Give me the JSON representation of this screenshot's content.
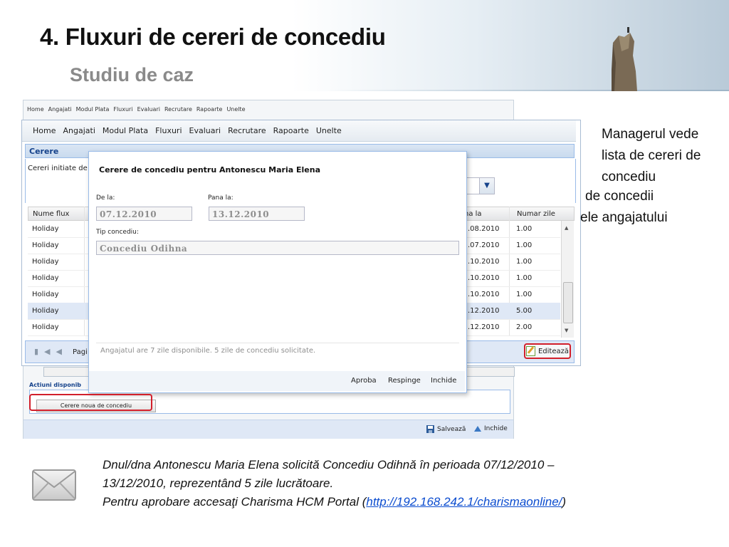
{
  "slide": {
    "title": "4. Fluxuri de cereri de concediu",
    "subtitle": "Studiu de caz"
  },
  "back_window": {
    "menu": [
      "Home",
      "Angajati",
      "Modul Plata",
      "Fluxuri",
      "Evaluari",
      "Recrutare",
      "Rapoarte",
      "Unelte"
    ],
    "actions_label": "Actiuni disponib",
    "new_request_button": "Cerere noua de concediu",
    "save_label": "Salvează",
    "close_label": "Inchide"
  },
  "mid_window": {
    "menu": [
      "Home",
      "Angajati",
      "Modul Plata",
      "Fluxuri",
      "Evaluari",
      "Recrutare",
      "Rapoarte",
      "Unelte"
    ],
    "panel_title": "Cerere",
    "filter_label": "Cereri initiate de",
    "grid": {
      "columns": [
        "Nume flux",
        "na la",
        "Numar zile"
      ],
      "rows": [
        {
          "flux": "Holiday",
          "end": ".08.2010",
          "days": "1.00",
          "selected": false
        },
        {
          "flux": "Holiday",
          "end": ".07.2010",
          "days": "1.00",
          "selected": false
        },
        {
          "flux": "Holiday",
          "end": ".10.2010",
          "days": "1.00",
          "selected": false
        },
        {
          "flux": "Holiday",
          "end": ".10.2010",
          "days": "1.00",
          "selected": false
        },
        {
          "flux": "Holiday",
          "end": ".10.2010",
          "days": "1.00",
          "selected": false
        },
        {
          "flux": "Holiday",
          "end": ".12.2010",
          "days": "5.00",
          "selected": true
        },
        {
          "flux": "Holiday",
          "end": ".12.2010",
          "days": "2.00",
          "selected": false
        }
      ]
    },
    "pager_label": "Pagi",
    "edit_button": "Editează"
  },
  "modal": {
    "title": "Cerere de concediu pentru Antonescu Maria Elena",
    "from_label": "De la:",
    "from_value": "07.12.2010",
    "to_label": "Pana la:",
    "to_value": "13.12.2010",
    "type_label": "Tip concediu:",
    "type_value": "Concediu Odihna",
    "info": "Angajatul are 7 zile disponibile. 5 zile de concediu solicitate.",
    "approve": "Aproba",
    "reject": "Respinge",
    "close": "Inchide"
  },
  "callout": {
    "text": "Managerul vede lista de cereri de concediu",
    "behind_line1": "de concedii",
    "behind_line2": "ele angajatului"
  },
  "email": {
    "line1": "Dnul/dna Antonescu Maria Elena solicită Concediu Odihnă în perioada 07/12/2010 –",
    "line2": "13/12/2010, reprezentând 5 zile lucrătoare.",
    "line3_prefix": "Pentru aprobare accesaţi Charisma HCM Portal (",
    "link": "http://192.168.242.1/charismaonline/",
    "line3_suffix": ")"
  }
}
